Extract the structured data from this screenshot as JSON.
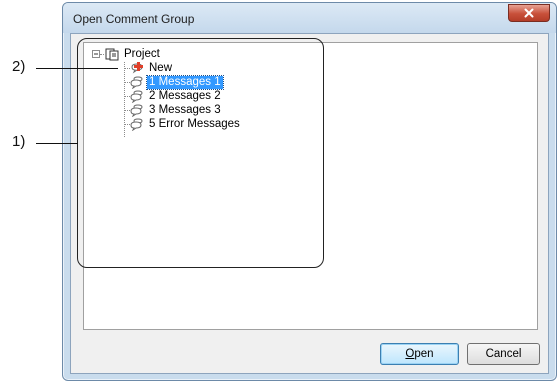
{
  "window": {
    "title": "Open Comment Group",
    "close_icon": "close-icon",
    "close_glyph": "x"
  },
  "tree": {
    "root": {
      "label": "Project",
      "icon": "project-icon",
      "expander_glyph": "−"
    },
    "items": [
      {
        "label": "New",
        "icon": "new-item-icon",
        "selected": false
      },
      {
        "label": "1 Messages 1",
        "icon": "comment-group-icon",
        "selected": true
      },
      {
        "label": "2 Messages 2",
        "icon": "comment-group-icon",
        "selected": false
      },
      {
        "label": "3 Messages 3",
        "icon": "comment-group-icon",
        "selected": false
      },
      {
        "label": "5 Error Messages",
        "icon": "comment-group-icon",
        "selected": false
      }
    ]
  },
  "buttons": {
    "open_accel": "O",
    "open_rest": "pen",
    "cancel": "Cancel"
  },
  "annotations": {
    "callout_1": "1)",
    "callout_2": "2)"
  },
  "colors": {
    "selection": "#3399ff",
    "close_button": "#c8503a",
    "window_frame": "#c9dced"
  }
}
